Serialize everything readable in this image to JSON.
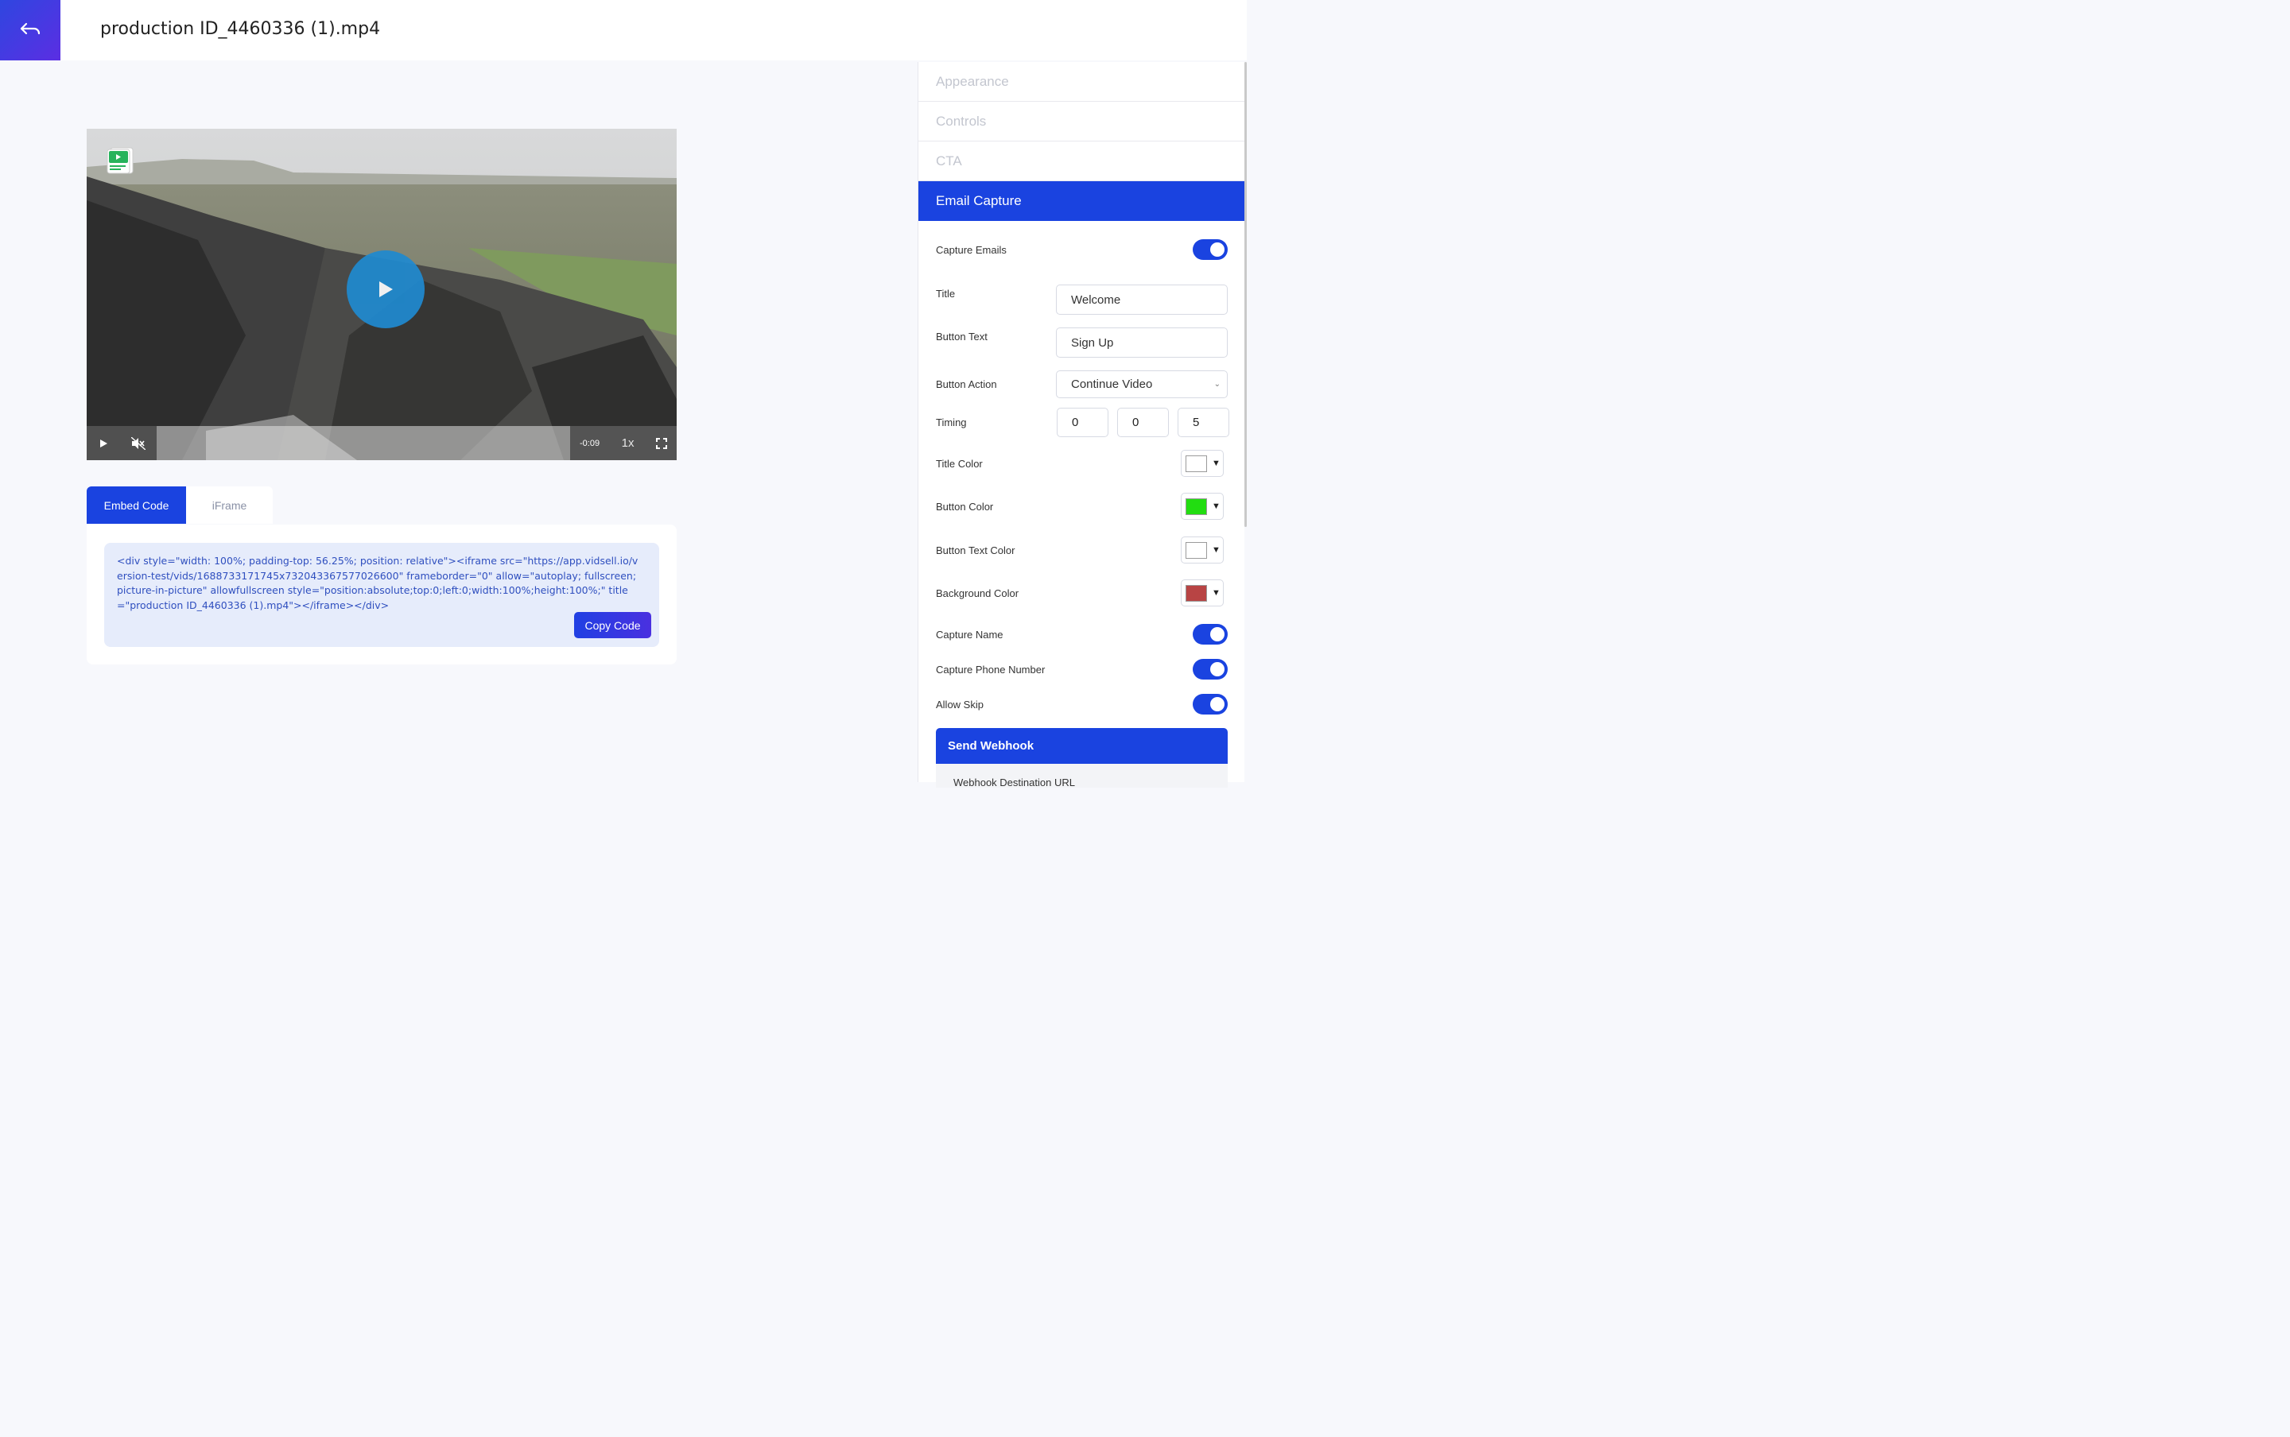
{
  "header": {
    "title": "production ID_4460336 (1).mp4"
  },
  "video": {
    "time": "-0:09",
    "speed": "1x"
  },
  "embed": {
    "tabs": [
      {
        "label": "Embed Code"
      },
      {
        "label": "iFrame"
      }
    ],
    "code": "<div style=\"width: 100%; padding-top: 56.25%; position: relative\"><iframe src=\"https://app.vidsell.io/version-test/vids/1688733171745x732043367577026600\" frameborder=\"0\" allow=\"autoplay; fullscreen; picture-in-picture\" allowfullscreen style=\"position:absolute;top:0;left:0;width:100%;height:100%;\" title=\"production ID_4460336 (1).mp4\"></iframe></div>",
    "copy_label": "Copy Code"
  },
  "panel": {
    "sections": [
      "Appearance",
      "Controls",
      "CTA",
      "Email Capture"
    ],
    "capture_emails": "Capture Emails",
    "title_label": "Title",
    "title_value": "Welcome",
    "button_text_label": "Button Text",
    "button_text_value": "Sign Up",
    "button_action_label": "Button Action",
    "button_action_value": "Continue Video",
    "timing_label": "Timing",
    "timing": [
      "0",
      "0",
      "5"
    ],
    "title_color_label": "Title Color",
    "button_color_label": "Button Color",
    "button_text_color_label": "Button Text Color",
    "background_color_label": "Background Color",
    "capture_name": "Capture Name",
    "capture_phone": "Capture Phone Number",
    "allow_skip": "Allow Skip",
    "send_webhook": "Send Webhook",
    "webhook_dest": "Webhook Destination URL"
  },
  "colors": {
    "accent": "#1a43e0",
    "title_color": "#ffffff",
    "button_color": "#22dd11",
    "button_text_color": "#ffffff",
    "background_color": "#b84444"
  }
}
